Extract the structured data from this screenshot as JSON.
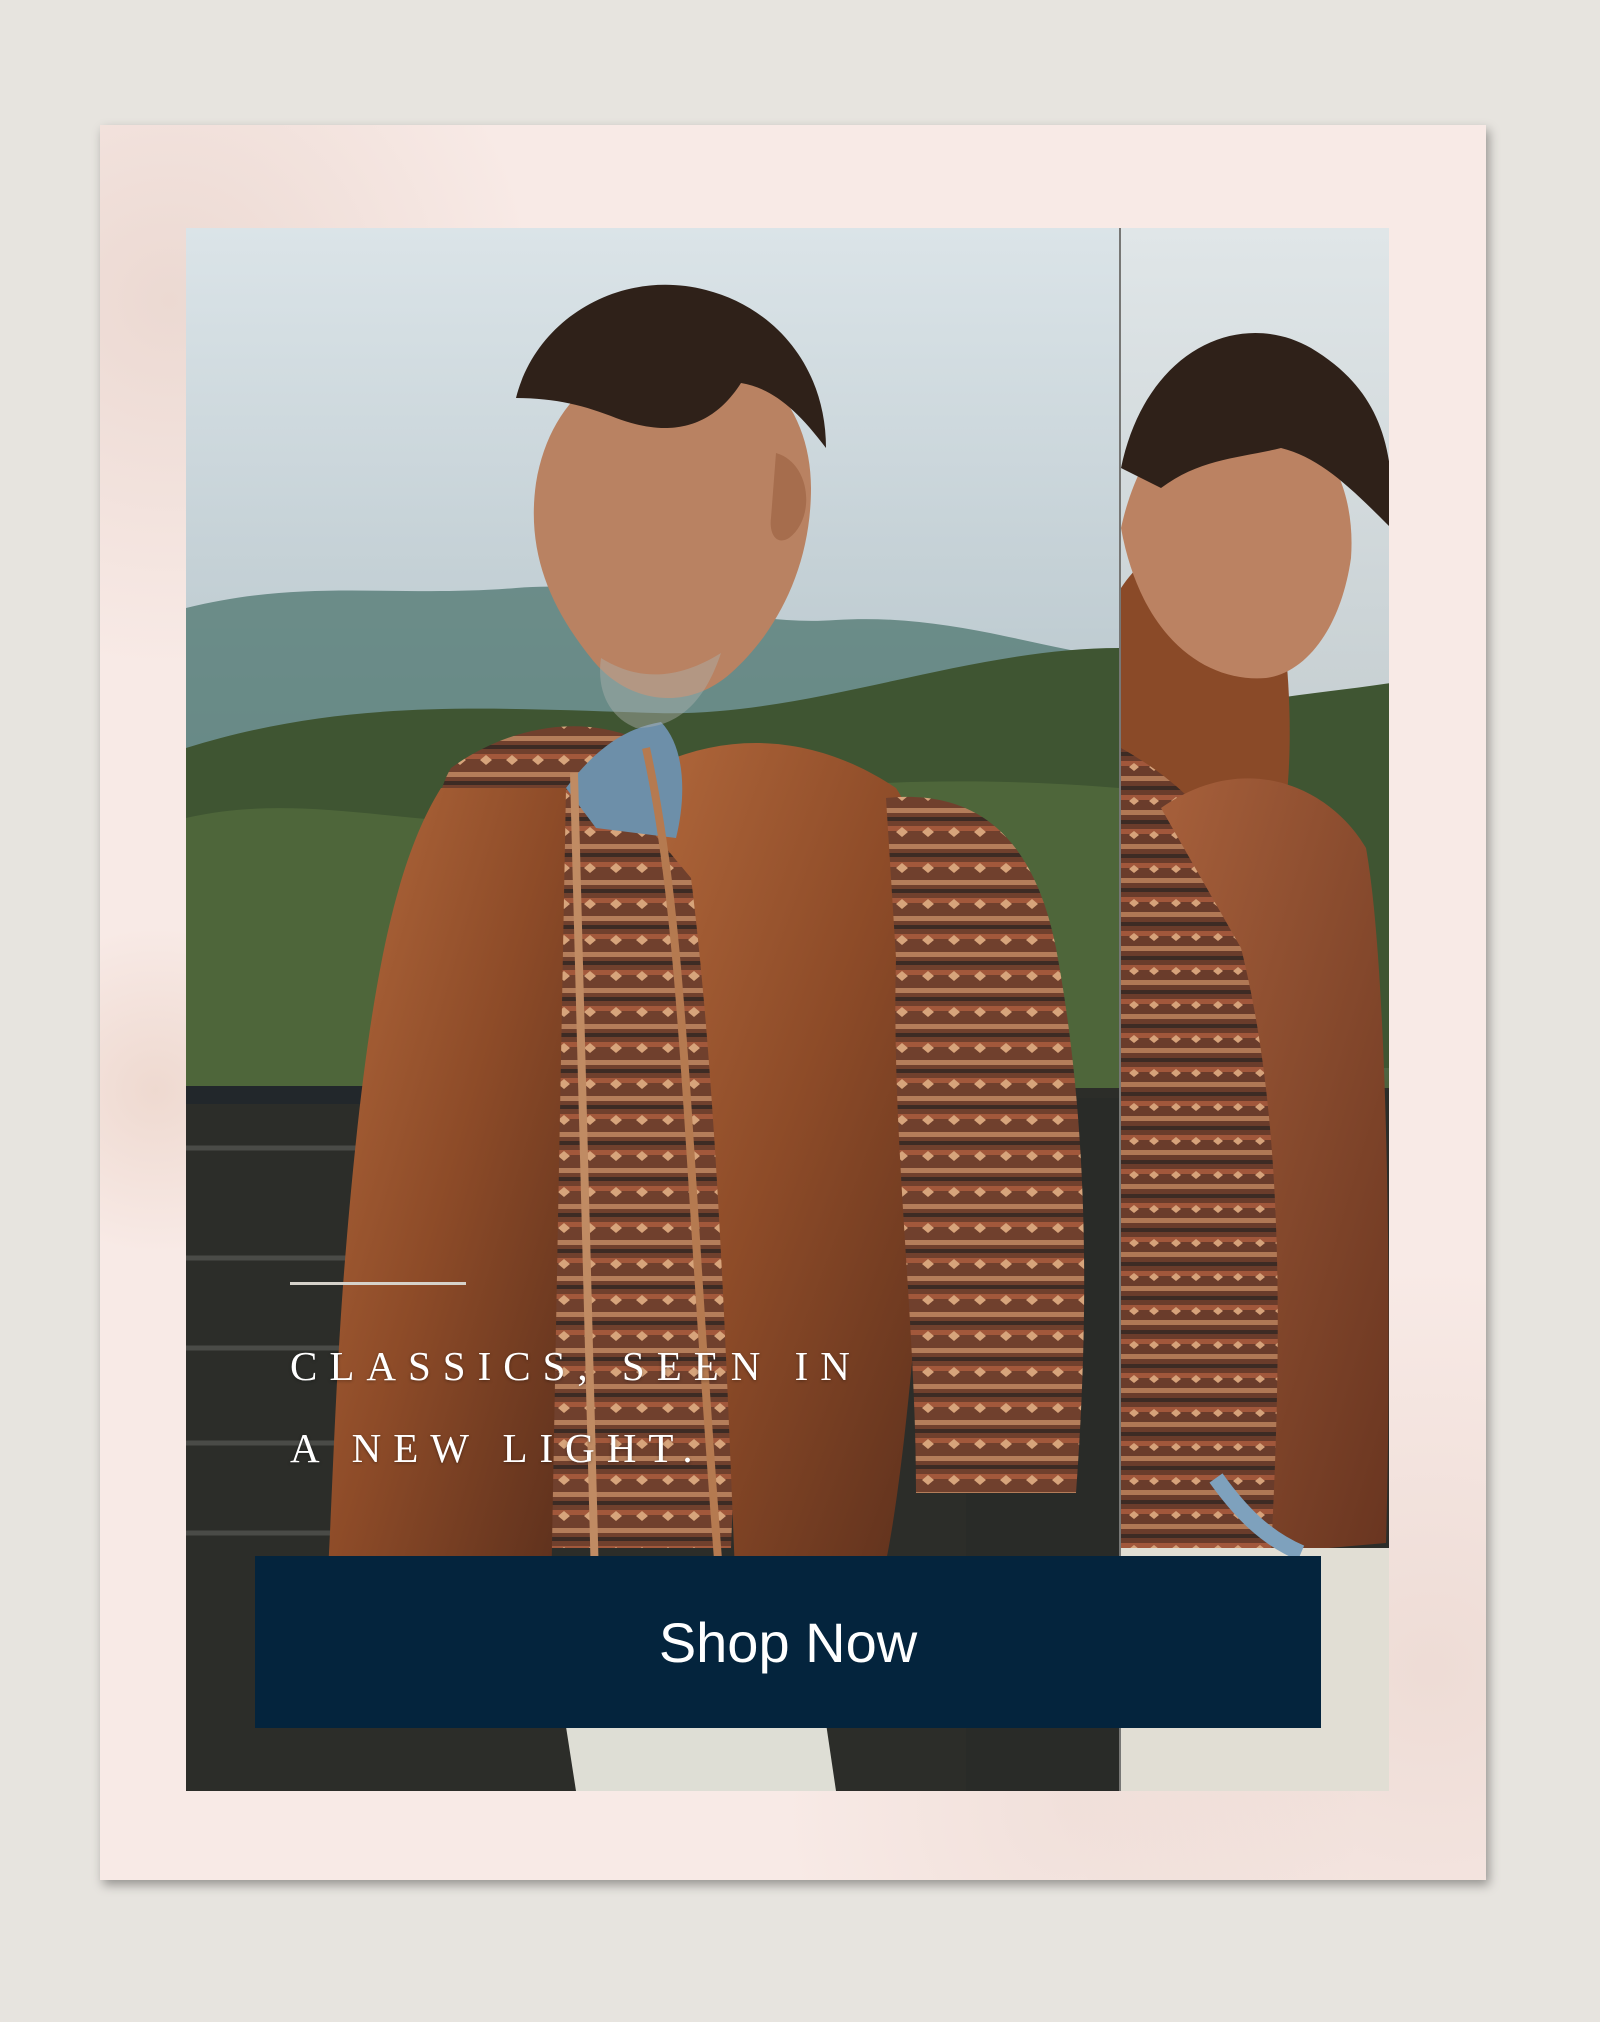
{
  "campaign": {
    "headline": {
      "line1": "CLASSICS, SEEN IN",
      "line2": "A NEW LIGHT."
    },
    "cta": {
      "label": "Shop Now"
    }
  },
  "colors": {
    "page_background": "#e7e4df",
    "paper": "#f8eae6",
    "button": "#04243d",
    "button_text": "#ffffff",
    "vest": "#8f4a25",
    "sweater_pattern": "#6f3c2c"
  },
  "image": {
    "subject": "man-in-rust-wool-vest-and-fair-isle-sweater",
    "scene": "mountain-landscape-with-railing",
    "reflection": "mirrored-side-profile"
  }
}
